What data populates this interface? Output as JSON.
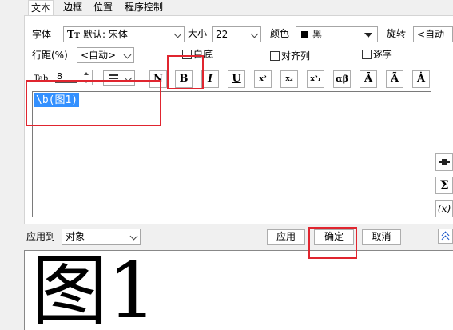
{
  "tabs": [
    "文本",
    "边框",
    "位置",
    "程序控制"
  ],
  "font": {
    "label": "字体",
    "value": "默认: 宋体"
  },
  "size": {
    "label": "大小",
    "value": "22"
  },
  "color": {
    "label": "颜色",
    "value": "黑",
    "swatch": "#000000"
  },
  "rotate": {
    "label": "旋转",
    "value": "<自动"
  },
  "line_spacing": {
    "label": "行距(%)",
    "value": "<自动>"
  },
  "checkboxes": {
    "white_bg": "白底",
    "align": "对齐列",
    "by_char": "逐字"
  },
  "tab": {
    "label": "Tab",
    "value": "8"
  },
  "format_buttons": {
    "normal": "N",
    "bold": "B",
    "italic": "I",
    "underline": "U",
    "superscript": "x²",
    "subscript": "x₂",
    "supsub": "x²₁",
    "greek": "αβ",
    "bar": "Ā",
    "tilde": "Ã",
    "dot": "Ȧ"
  },
  "editor": {
    "text": "\\b(图1)"
  },
  "side": {
    "sigma": "Σ",
    "var": "(x)"
  },
  "apply_to": {
    "label": "应用到",
    "value": "对象"
  },
  "buttons": {
    "apply": "应用",
    "ok": "确定",
    "cancel": "取消"
  },
  "preview": {
    "text": "图1"
  },
  "colors": {
    "highlight": "#e0252f",
    "selection": "#3390ff"
  }
}
